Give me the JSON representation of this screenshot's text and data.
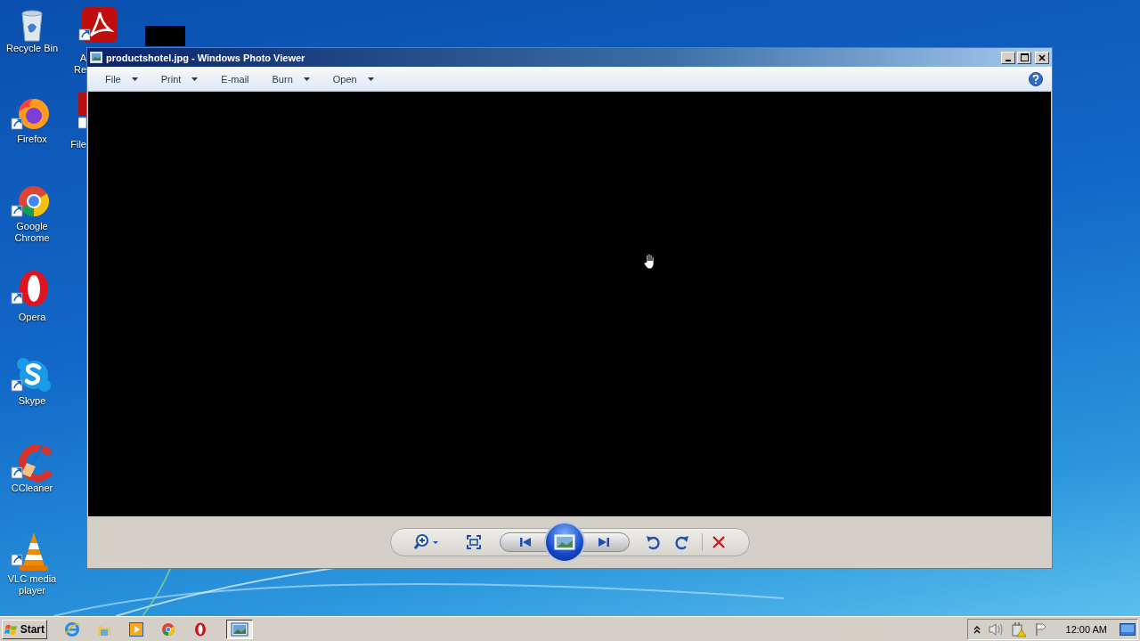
{
  "desktop": {
    "icons": [
      {
        "kind": "recycle",
        "lines": [
          "Recycle Bin"
        ]
      },
      {
        "kind": "firefox",
        "lines": [
          "Firefox"
        ]
      },
      {
        "kind": "chrome",
        "lines": [
          "Google",
          "Chrome"
        ]
      },
      {
        "kind": "opera",
        "lines": [
          "Opera"
        ]
      },
      {
        "kind": "skype",
        "lines": [
          "Skype"
        ]
      },
      {
        "kind": "ccleaner",
        "lines": [
          "CCleaner"
        ]
      },
      {
        "kind": "vlc",
        "lines": [
          "VLC media",
          "player"
        ]
      }
    ],
    "covered_icons": [
      {
        "kind": "pdf",
        "lines": [
          "A",
          "Re"
        ]
      },
      {
        "kind": "app",
        "lines": [
          "File"
        ]
      },
      {
        "kind": "blank"
      }
    ]
  },
  "window": {
    "title": "productshotel.jpg - Windows Photo Viewer",
    "menu": [
      {
        "label": "File",
        "dropdown": true
      },
      {
        "label": "Print",
        "dropdown": true
      },
      {
        "label": "E-mail",
        "dropdown": false
      },
      {
        "label": "Burn",
        "dropdown": true
      },
      {
        "label": "Open",
        "dropdown": true
      }
    ]
  },
  "taskbar": {
    "start": "Start",
    "items": [
      {
        "kind": "ie",
        "selected": false
      },
      {
        "kind": "explorer",
        "selected": false
      },
      {
        "kind": "media",
        "selected": false
      },
      {
        "kind": "chrome",
        "selected": false
      },
      {
        "kind": "opera",
        "selected": false
      },
      {
        "kind": "photo_viewer",
        "selected": true
      }
    ],
    "clock": "12:00 AM"
  }
}
